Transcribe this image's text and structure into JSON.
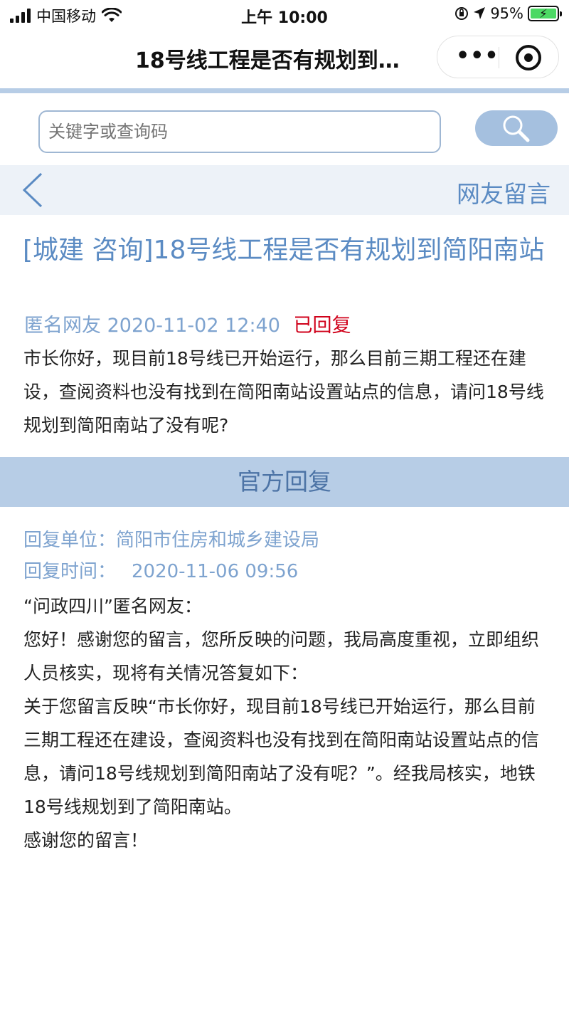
{
  "status_bar": {
    "carrier": "中国移动",
    "time": "上午 10:00",
    "battery": "95%"
  },
  "nav": {
    "title": "18号线工程是否有规划到…",
    "more_label": "•••"
  },
  "search": {
    "placeholder": "关键字或查询码"
  },
  "sub_header": {
    "label": "网友留言"
  },
  "post": {
    "title": "[城建 咨询]18号线工程是否有规划到简阳南站",
    "author": "匿名网友",
    "datetime": "2020-11-02 12:40",
    "status": "已回复",
    "content": "市长你好，现目前18号线已开始运行，那么目前三期工程还在建设，查阅资料也没有找到在简阳南站设置站点的信息，请问18号线规划到简阳南站了没有呢?"
  },
  "reply": {
    "section_title": "官方回复",
    "unit_label": "回复单位：",
    "unit": "简阳市住房和城乡建设局",
    "time_label": "回复时间：",
    "time": "2020-11-06 09:56",
    "lines": [
      "“问政四川”匿名网友：",
      "您好！感谢您的留言，您所反映的问题，我局高度重视，立即组织人员核实，现将有关情况答复如下：",
      "关于您留言反映“市长你好，现目前18号线已开始运行，那么目前三期工程还在建设，查阅资料也没有找到在简阳南站设置站点的信息，请问18号线规划到简阳南站了没有呢？”。经我局核实，地铁18号线规划到了简阳南站。",
      "感谢您的留言！"
    ]
  },
  "colors": {
    "accent": "#5b8bc3",
    "status_red": "#d0021b",
    "stripe": "#b7cde6"
  }
}
